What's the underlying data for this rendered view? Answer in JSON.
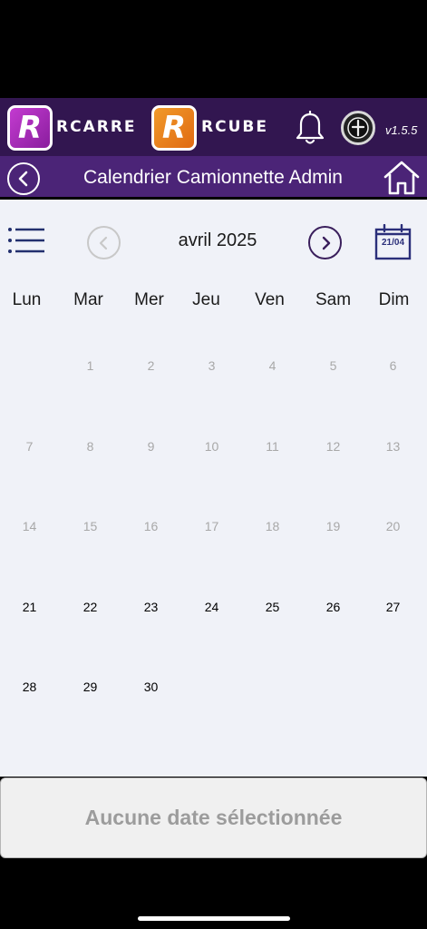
{
  "brand": {
    "rcarre_letter": "R",
    "rcarre_name": "RCARRE",
    "rcube_letter": "R",
    "rcube_name": "RCUBE",
    "version": "v1.5.5",
    "bar_color": "#321650"
  },
  "header": {
    "title": "Calendrier Camionnette Admin",
    "icons": [
      "back-icon",
      "home-icon",
      "bell-icon",
      "profile-icon"
    ],
    "bar_color": "#4b2477"
  },
  "calendar": {
    "month_label": "avril 2025",
    "today_label": "21/04",
    "weekdays": [
      "Lun",
      "Mar",
      "Mer",
      "Jeu",
      "Ven",
      "Sam",
      "Dim"
    ],
    "first_weekday_offset": 1,
    "days_in_month": 30,
    "first_selectable_day": 21,
    "icons": [
      "menu-list-icon",
      "prev-month-icon",
      "next-month-icon",
      "today-calendar-icon"
    ]
  },
  "selection": {
    "text": "Aucune date sélectionnée"
  },
  "colors": {
    "accent_purple": "#4b2477",
    "disabled_day": "#a8a8a8",
    "calendar_bg": "#f0f2f8"
  }
}
